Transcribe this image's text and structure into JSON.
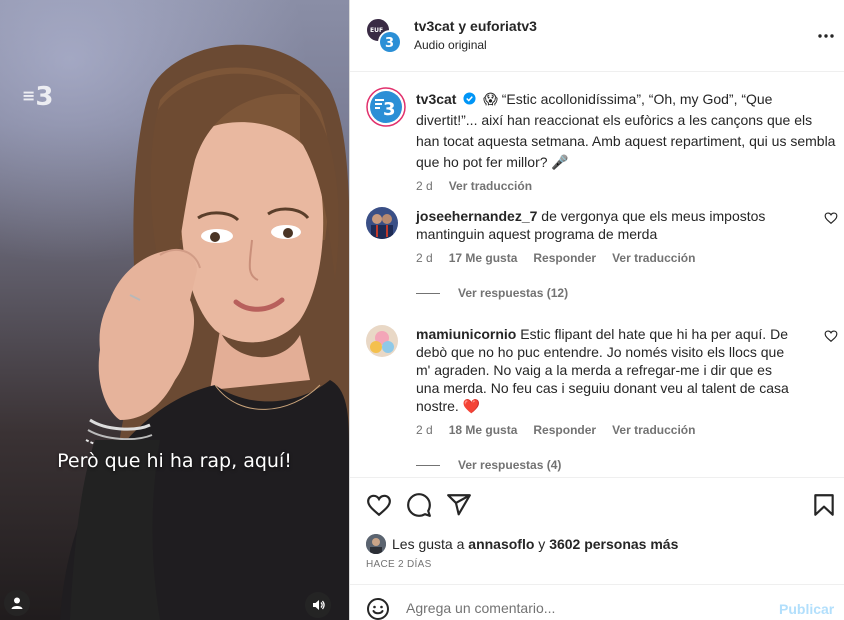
{
  "video": {
    "watermark": "3",
    "subtitle": "Però que hi ha rap, aquí!"
  },
  "header": {
    "title": "tv3cat y euforiatv3",
    "subtitle": "Audio original"
  },
  "caption": {
    "username": "tv3cat",
    "text": "😱 “Estic acollonidíssima”, “Oh, my God”, “Que divertit!”... així han reaccionat els eufòrics a les cançons que els han tocat aquesta setmana. Amb aquest repartiment, qui us sembla que ho pot fer millor? 🎤",
    "time": "2 d",
    "translate": "Ver traducción"
  },
  "comments": [
    {
      "username": "joseehernandez_7",
      "text": "de vergonya que els meus impostos mantinguin aquest programa de merda",
      "time": "2 d",
      "likes": "17 Me gusta",
      "reply": "Responder",
      "translate": "Ver traducción",
      "replies": "Ver respuestas (12)"
    },
    {
      "username": "mamiunicornio",
      "text": "Estic flipant del hate que hi ha per aquí. De debò que no ho puc entendre. Jo només visito els llocs que m' agraden. No vaig a la merda a refregar-me i dir que es una merda. No feu cas i seguiu donant veu al talent de casa nostre. ❤️",
      "time": "2 d",
      "likes": "18 Me gusta",
      "reply": "Responder",
      "translate": "Ver traducción",
      "replies": "Ver respuestas (4)"
    }
  ],
  "likes": {
    "prefix": "Les gusta a",
    "user": "annasoflo",
    "connector": "y",
    "others": "3602 personas más"
  },
  "time_ago": "HACE 2 DÍAS",
  "add_comment": {
    "placeholder": "Agrega un comentario...",
    "publish": "Publicar"
  },
  "colors": {
    "accent": "#0095f6",
    "publish_disabled": "#b2dffc",
    "muted": "#737373",
    "verified": "#0095f6",
    "tv3_blue": "#2b8fd6"
  },
  "icons": [
    "user-icon",
    "volume-icon",
    "more-icon",
    "verified-icon",
    "heart-icon",
    "comment-icon",
    "share-icon",
    "save-icon",
    "emoji-icon"
  ]
}
